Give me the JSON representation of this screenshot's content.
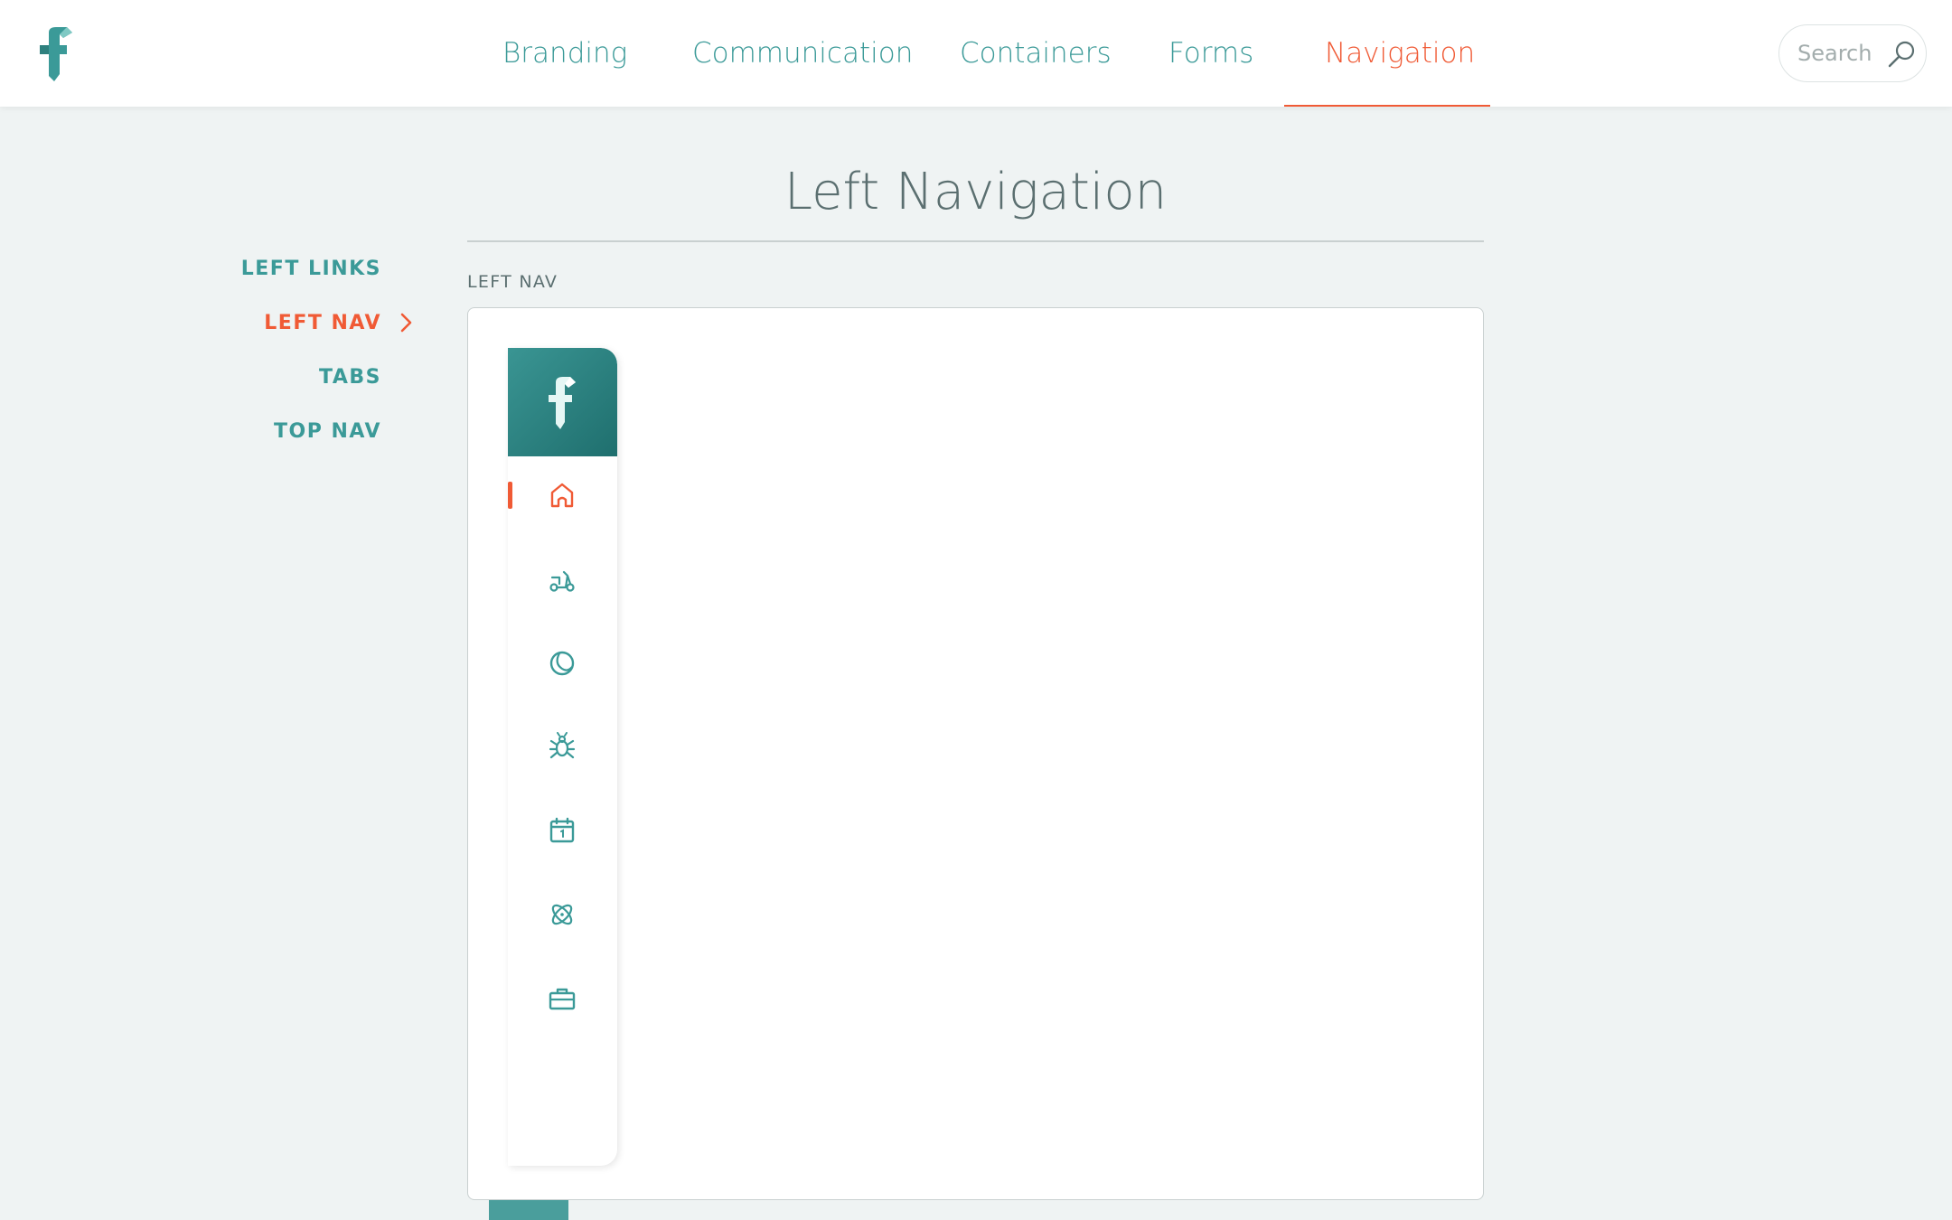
{
  "header": {
    "logo_icon": "brand-f-logo",
    "nav": [
      {
        "label": "Branding",
        "active": false
      },
      {
        "label": "Communication",
        "active": false
      },
      {
        "label": "Containers",
        "active": false
      },
      {
        "label": "Forms",
        "active": false
      },
      {
        "label": "Navigation",
        "active": true
      }
    ],
    "search": {
      "placeholder": "Search",
      "value": "",
      "icon": "search-icon"
    }
  },
  "page": {
    "title": "Left Navigation"
  },
  "sidebar": {
    "items": [
      {
        "label": "LEFT LINKS",
        "active": false
      },
      {
        "label": "LEFT NAV",
        "active": true
      },
      {
        "label": "TABS",
        "active": false
      },
      {
        "label": "TOP NAV",
        "active": false
      }
    ]
  },
  "section": {
    "label": "LEFT NAV"
  },
  "demo_leftnav": {
    "logo_icon": "brand-f-logo",
    "items": [
      {
        "icon": "home-icon",
        "active": true
      },
      {
        "icon": "scooter-icon",
        "active": false
      },
      {
        "icon": "moon-globe-icon",
        "active": false
      },
      {
        "icon": "bug-icon",
        "active": false
      },
      {
        "icon": "calendar-icon",
        "active": false
      },
      {
        "icon": "atom-icon",
        "active": false
      },
      {
        "icon": "briefcase-icon",
        "active": false
      }
    ]
  },
  "colors": {
    "accent": "#f05a35",
    "primary": "#3b9a98",
    "background": "#eff3f3"
  }
}
